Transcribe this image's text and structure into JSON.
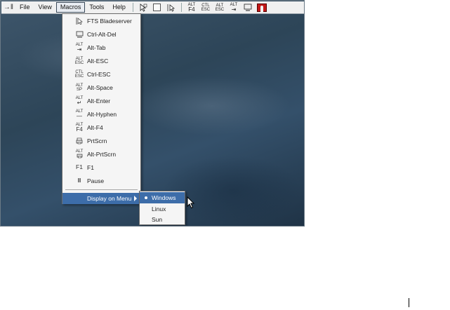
{
  "toolbar": {
    "menus": [
      "File",
      "View",
      "Macros",
      "Tools",
      "Help"
    ],
    "active_menu": "Macros",
    "buttons": [
      {
        "icon": "select-pointer-icon",
        "top": "",
        "bottom": ""
      },
      {
        "icon": "scale-screen-icon",
        "top": "",
        "bottom": ""
      },
      {
        "icon": "single-cursor-icon",
        "top": "",
        "bottom": ""
      },
      {
        "icon": "alt-f4-icon",
        "top": "ALT",
        "bottom": "F4"
      },
      {
        "icon": "ctrl-esc-icon",
        "top": "CTL",
        "bottom": "ESC"
      },
      {
        "icon": "alt-esc-icon",
        "top": "ALT",
        "bottom": "ESC"
      },
      {
        "icon": "alt-tab-icon",
        "top": "ALT",
        "bottom": "⇥"
      },
      {
        "icon": "monitor-icon",
        "top": "",
        "bottom": ""
      },
      {
        "icon": "user-icon",
        "top": "",
        "bottom": ""
      }
    ]
  },
  "macros_menu": {
    "items": [
      {
        "label": "FTS Bladeserver",
        "icon": "pointer-icon",
        "top": "",
        "bottom": "▷"
      },
      {
        "label": "Ctrl-Alt-Del",
        "icon": "keyboard-icon",
        "top": "",
        "bottom": "▭"
      },
      {
        "label": "Alt-Tab",
        "icon": "alt-tab-icon",
        "top": "ALT",
        "bottom": "⇥"
      },
      {
        "label": "Alt-ESC",
        "icon": "alt-esc-icon",
        "top": "ALT",
        "bottom": "ESC"
      },
      {
        "label": "Ctrl-ESC",
        "icon": "ctrl-esc-icon",
        "top": "CTL",
        "bottom": "ESC"
      },
      {
        "label": "Alt-Space",
        "icon": "alt-space-icon",
        "top": "ALT",
        "bottom": "SP"
      },
      {
        "label": "Alt-Enter",
        "icon": "alt-enter-icon",
        "top": "ALT",
        "bottom": "↵"
      },
      {
        "label": "Alt-Hyphen",
        "icon": "alt-hyphen-icon",
        "top": "ALT",
        "bottom": "—"
      },
      {
        "label": "Alt-F4",
        "icon": "alt-f4-icon",
        "top": "ALT",
        "bottom": "F4"
      },
      {
        "label": "PrtScrn",
        "icon": "printer-icon",
        "top": "",
        "bottom": "⎙"
      },
      {
        "label": "Alt-PrtScrn",
        "icon": "alt-printer-icon",
        "top": "ALT",
        "bottom": "⎙"
      },
      {
        "label": "F1",
        "icon": "f1-icon",
        "top": "",
        "bottom": "F1"
      },
      {
        "label": "Pause",
        "icon": "pause-icon",
        "top": "",
        "bottom": "II"
      }
    ],
    "display_on_menu": "Display on Menu"
  },
  "submenu": {
    "items": [
      "Windows",
      "Linux",
      "Sun"
    ],
    "selected": "Windows"
  },
  "colors": {
    "highlight": "#3d6da9",
    "menu_bg": "#f5f5f5",
    "desktop": "#2d4558"
  }
}
